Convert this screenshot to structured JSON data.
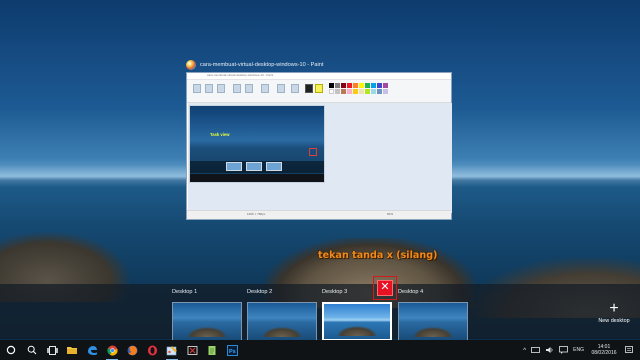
{
  "window": {
    "title": "cara-membuat-virtual-desktop-windows-10 - Paint",
    "paint_titlebar_text": "cara-membuat-virtual-desktop-windows-10 - Paint",
    "screenshot_caption": "Task view",
    "status_size": "1366 × 768px",
    "status_zoom": "50%"
  },
  "annotation": {
    "text": "tekan tanda x (silang)"
  },
  "desktops": [
    {
      "label": "Desktop 1",
      "active": false
    },
    {
      "label": "Desktop 2",
      "active": false
    },
    {
      "label": "Desktop 3",
      "active": true
    },
    {
      "label": "Desktop 4",
      "active": false
    }
  ],
  "desktop_close": {
    "icon": "close-icon",
    "glyph": "✕"
  },
  "new_desktop": {
    "label": "New desktop",
    "glyph": "+"
  },
  "taskbar": {
    "apps": [
      {
        "name": "start-icon"
      },
      {
        "name": "search-icon"
      },
      {
        "name": "task-view-icon"
      },
      {
        "name": "file-explorer-icon"
      },
      {
        "name": "edge-icon"
      },
      {
        "name": "chrome-icon"
      },
      {
        "name": "firefox-icon"
      },
      {
        "name": "opera-icon"
      },
      {
        "name": "paint-icon"
      },
      {
        "name": "snipping-tool-icon"
      },
      {
        "name": "notepad-icon"
      },
      {
        "name": "photoshop-icon"
      }
    ],
    "tray": {
      "language": "ENG",
      "time": "14:01",
      "date": "08/02/2016"
    }
  },
  "colors": {
    "annotation": "#f08a1c",
    "close_button": "#e81123",
    "taskbar": "#101316"
  }
}
